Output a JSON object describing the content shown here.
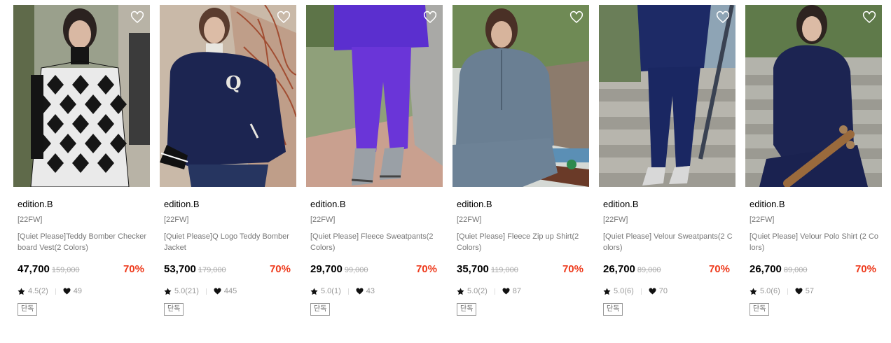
{
  "products": [
    {
      "brand": "edition.B",
      "season": "[22FW]",
      "name": "[Quiet Please]Teddy Bomber Checkerboard Vest(2 Colors)",
      "price": "47,700",
      "original_price": "159,000",
      "discount": "70%",
      "rating": "4.5(2)",
      "likes": "49",
      "badge": "단독",
      "image_icon": "checkerboard-vest-photo"
    },
    {
      "brand": "edition.B",
      "season": "[22FW]",
      "name": "[Quiet Please]Q Logo Teddy Bomber Jacket",
      "price": "53,700",
      "original_price": "179,000",
      "discount": "70%",
      "rating": "5.0(21)",
      "likes": "445",
      "badge": "단독",
      "image_icon": "teddy-bomber-photo"
    },
    {
      "brand": "edition.B",
      "season": "[22FW]",
      "name": "[Quiet Please] Fleece Sweatpants(2 Colors)",
      "price": "29,700",
      "original_price": "99,000",
      "discount": "70%",
      "rating": "5.0(1)",
      "likes": "43",
      "badge": "단독",
      "image_icon": "purple-sweatpants-photo"
    },
    {
      "brand": "edition.B",
      "season": "[22FW]",
      "name": "[Quiet Please] Fleece Zip up Shirt(2 Colors)",
      "price": "35,700",
      "original_price": "119,000",
      "discount": "70%",
      "rating": "5.0(2)",
      "likes": "87",
      "badge": "단독",
      "image_icon": "fleece-zip-photo"
    },
    {
      "brand": "edition.B",
      "season": "[22FW]",
      "name": "[Quiet Please] Velour Sweatpants(2 Colors)",
      "price": "26,700",
      "original_price": "89,000",
      "discount": "70%",
      "rating": "5.0(6)",
      "likes": "70",
      "badge": "단독",
      "image_icon": "velour-sweatpants-photo"
    },
    {
      "brand": "edition.B",
      "season": "[22FW]",
      "name": "[Quiet Please] Velour Polo Shirt (2 Colors)",
      "price": "26,700",
      "original_price": "89,000",
      "discount": "70%",
      "rating": "5.0(6)",
      "likes": "57",
      "badge": "단독",
      "image_icon": "velour-polo-photo"
    }
  ],
  "colors": {
    "sale": "#ee3a1c",
    "muted": "#777777",
    "strike": "#aaaaaa"
  }
}
